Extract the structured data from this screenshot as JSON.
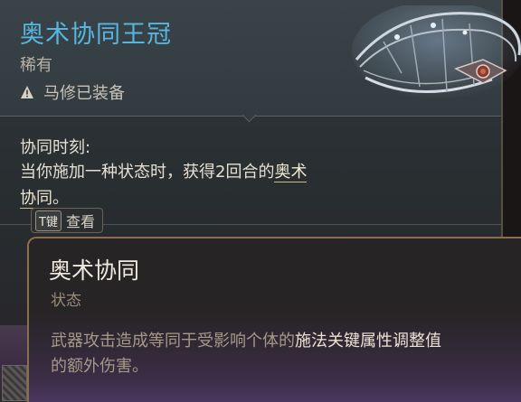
{
  "item": {
    "name": "奥术协同王冠",
    "rarity": "稀有",
    "equipped_status": "马修已装备",
    "icon": "circlet-art"
  },
  "passive": {
    "title": "协同时刻:",
    "desc_prefix": "当你施加一种状态时，获得2回合的",
    "desc_link_a": "奥术",
    "desc_link_b": "协同",
    "desc_suffix": "。"
  },
  "key_hint": {
    "key": "T键",
    "label": "查看"
  },
  "keyword": {
    "title": "奥术协同",
    "type": "状态",
    "desc_prefix": "武器攻击造成等同于受影响个体的",
    "desc_highlight": "施法关键属性调整值",
    "desc_suffix": "的额外伤害。"
  },
  "colors": {
    "item_name": "#56b6e0",
    "keyword_highlight": "#ece4d4",
    "keyword_border": "#8a6e4e"
  }
}
